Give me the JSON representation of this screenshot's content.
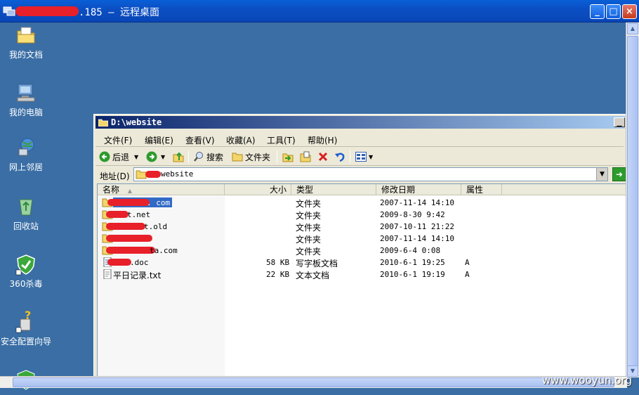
{
  "rdp": {
    "title": ".185 – 远程桌面",
    "buttons": {
      "minimize": "_",
      "maximize": "□",
      "close": "×"
    }
  },
  "desktop_icons": [
    {
      "label": "我的文档",
      "icon": "my-documents-icon"
    },
    {
      "label": "我的电脑",
      "icon": "my-computer-icon"
    },
    {
      "label": "网上邻居",
      "icon": "network-places-icon"
    },
    {
      "label": "回收站",
      "icon": "recycle-bin-icon"
    },
    {
      "label": "360杀毒",
      "icon": "360-antivirus-icon"
    },
    {
      "label": "安全配置向导",
      "icon": "security-wizard-icon"
    }
  ],
  "explorer": {
    "title": "D:\\website",
    "menu": [
      "文件(F)",
      "编辑(E)",
      "查看(V)",
      "收藏(A)",
      "工具(T)",
      "帮助(H)"
    ],
    "toolbar": {
      "back": "后退",
      "search": "搜索",
      "folders": "文件夹"
    },
    "address_label": "地址(D)",
    "address_value": "website",
    "columns": [
      "名称",
      "大小",
      "类型",
      "修改日期",
      "属性"
    ],
    "files": [
      {
        "name": ". com",
        "size": "",
        "type": "文件夹",
        "date": "2007-11-14 14:10",
        "attr": ""
      },
      {
        "name": "t.net",
        "size": "",
        "type": "文件夹",
        "date": "2009-8-30 9:42",
        "attr": ""
      },
      {
        "name": "t.old",
        "size": "",
        "type": "文件夹",
        "date": "2007-10-11 21:22",
        "attr": ""
      },
      {
        "name": "",
        "size": "",
        "type": "文件夹",
        "date": "2007-11-14 14:10",
        "attr": ""
      },
      {
        "name": "ta.com",
        "size": "",
        "type": "文件夹",
        "date": "2009-6-4 0:08",
        "attr": ""
      },
      {
        "name": ".doc",
        "size": "58 KB",
        "type": "写字板文档",
        "date": "2010-6-1 19:25",
        "attr": "A"
      },
      {
        "name": "平日记录.txt",
        "size": "22 KB",
        "type": "文本文档",
        "date": "2010-6-1 19:19",
        "attr": "A"
      }
    ]
  },
  "watermark": "www.wooyun.org",
  "colors": {
    "desktop": "#3a6ea5",
    "titlebar": "#0b4fc4",
    "redaction": "#e8202a"
  }
}
